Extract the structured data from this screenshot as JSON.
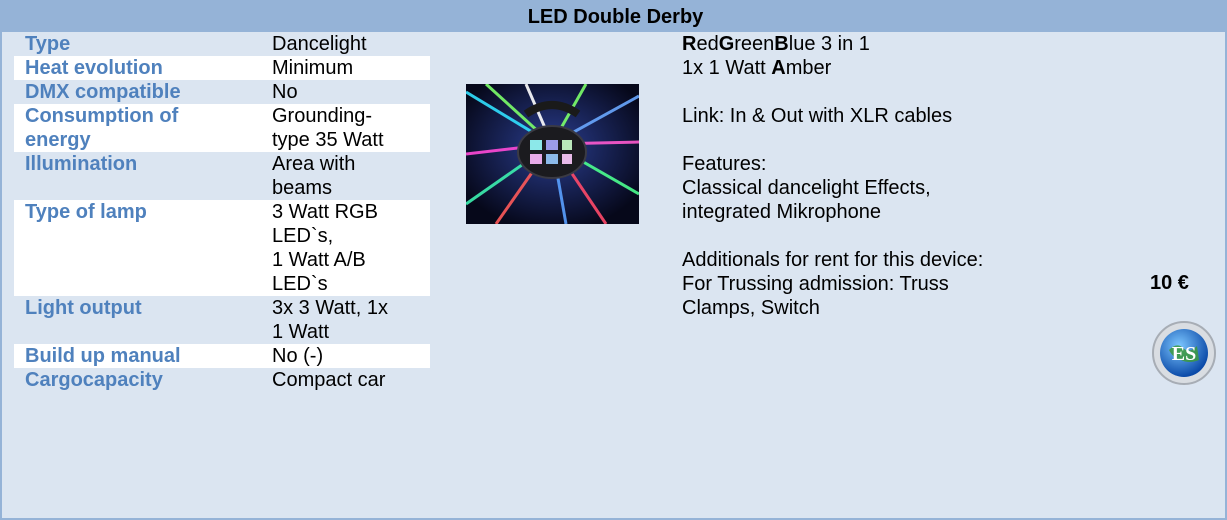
{
  "title": "LED Double Derby",
  "specs": [
    {
      "key": "Type",
      "lines": [
        "Dancelight"
      ]
    },
    {
      "key": "Heat evolution",
      "lines": [
        "Minimum"
      ]
    },
    {
      "key": "DMX compatible",
      "lines": [
        "No"
      ]
    },
    {
      "key_lines": [
        "Consumption of",
        "energy"
      ],
      "lines": [
        "Grounding-",
        "type 35 Watt"
      ]
    },
    {
      "key": "Illumination",
      "lines": [
        "Area with",
        "beams"
      ]
    },
    {
      "key": "Type of lamp",
      "lines": [
        "3 Watt RGB",
        "LED`s,",
        "1 Watt A/B",
        "LED`s"
      ]
    },
    {
      "key": "Light output",
      "lines": [
        "3x 3 Watt, 1x",
        "1 Watt"
      ]
    },
    {
      "key": "Build up manual",
      "lines": [
        "No (-)"
      ]
    },
    {
      "key": "Cargocapacity",
      "lines": [
        "Compact car"
      ]
    }
  ],
  "description": {
    "line1": {
      "b1": "R",
      "t1": "ed",
      "b2": "G",
      "t2": "reen",
      "b3": "B",
      "t3": "lue 3 in 1"
    },
    "line2": {
      "t1": "1x 1 Watt ",
      "b1": "A",
      "t2": "mber"
    },
    "link": "Link: In & Out with XLR cables",
    "features_label": "Features:",
    "features_1": "Classical dancelight Effects,",
    "features_2": "integrated Mikrophone",
    "additionals_label": "Additionals for rent for this device:",
    "additionals_1": "For Trussing admission: Truss",
    "additionals_2": "Clamps, Switch"
  },
  "price": "10 €",
  "logo_text": "ES",
  "colors": {
    "header_bg": "#95b3d7",
    "row_bg": "#dbe5f1",
    "label": "#4f81bd"
  }
}
